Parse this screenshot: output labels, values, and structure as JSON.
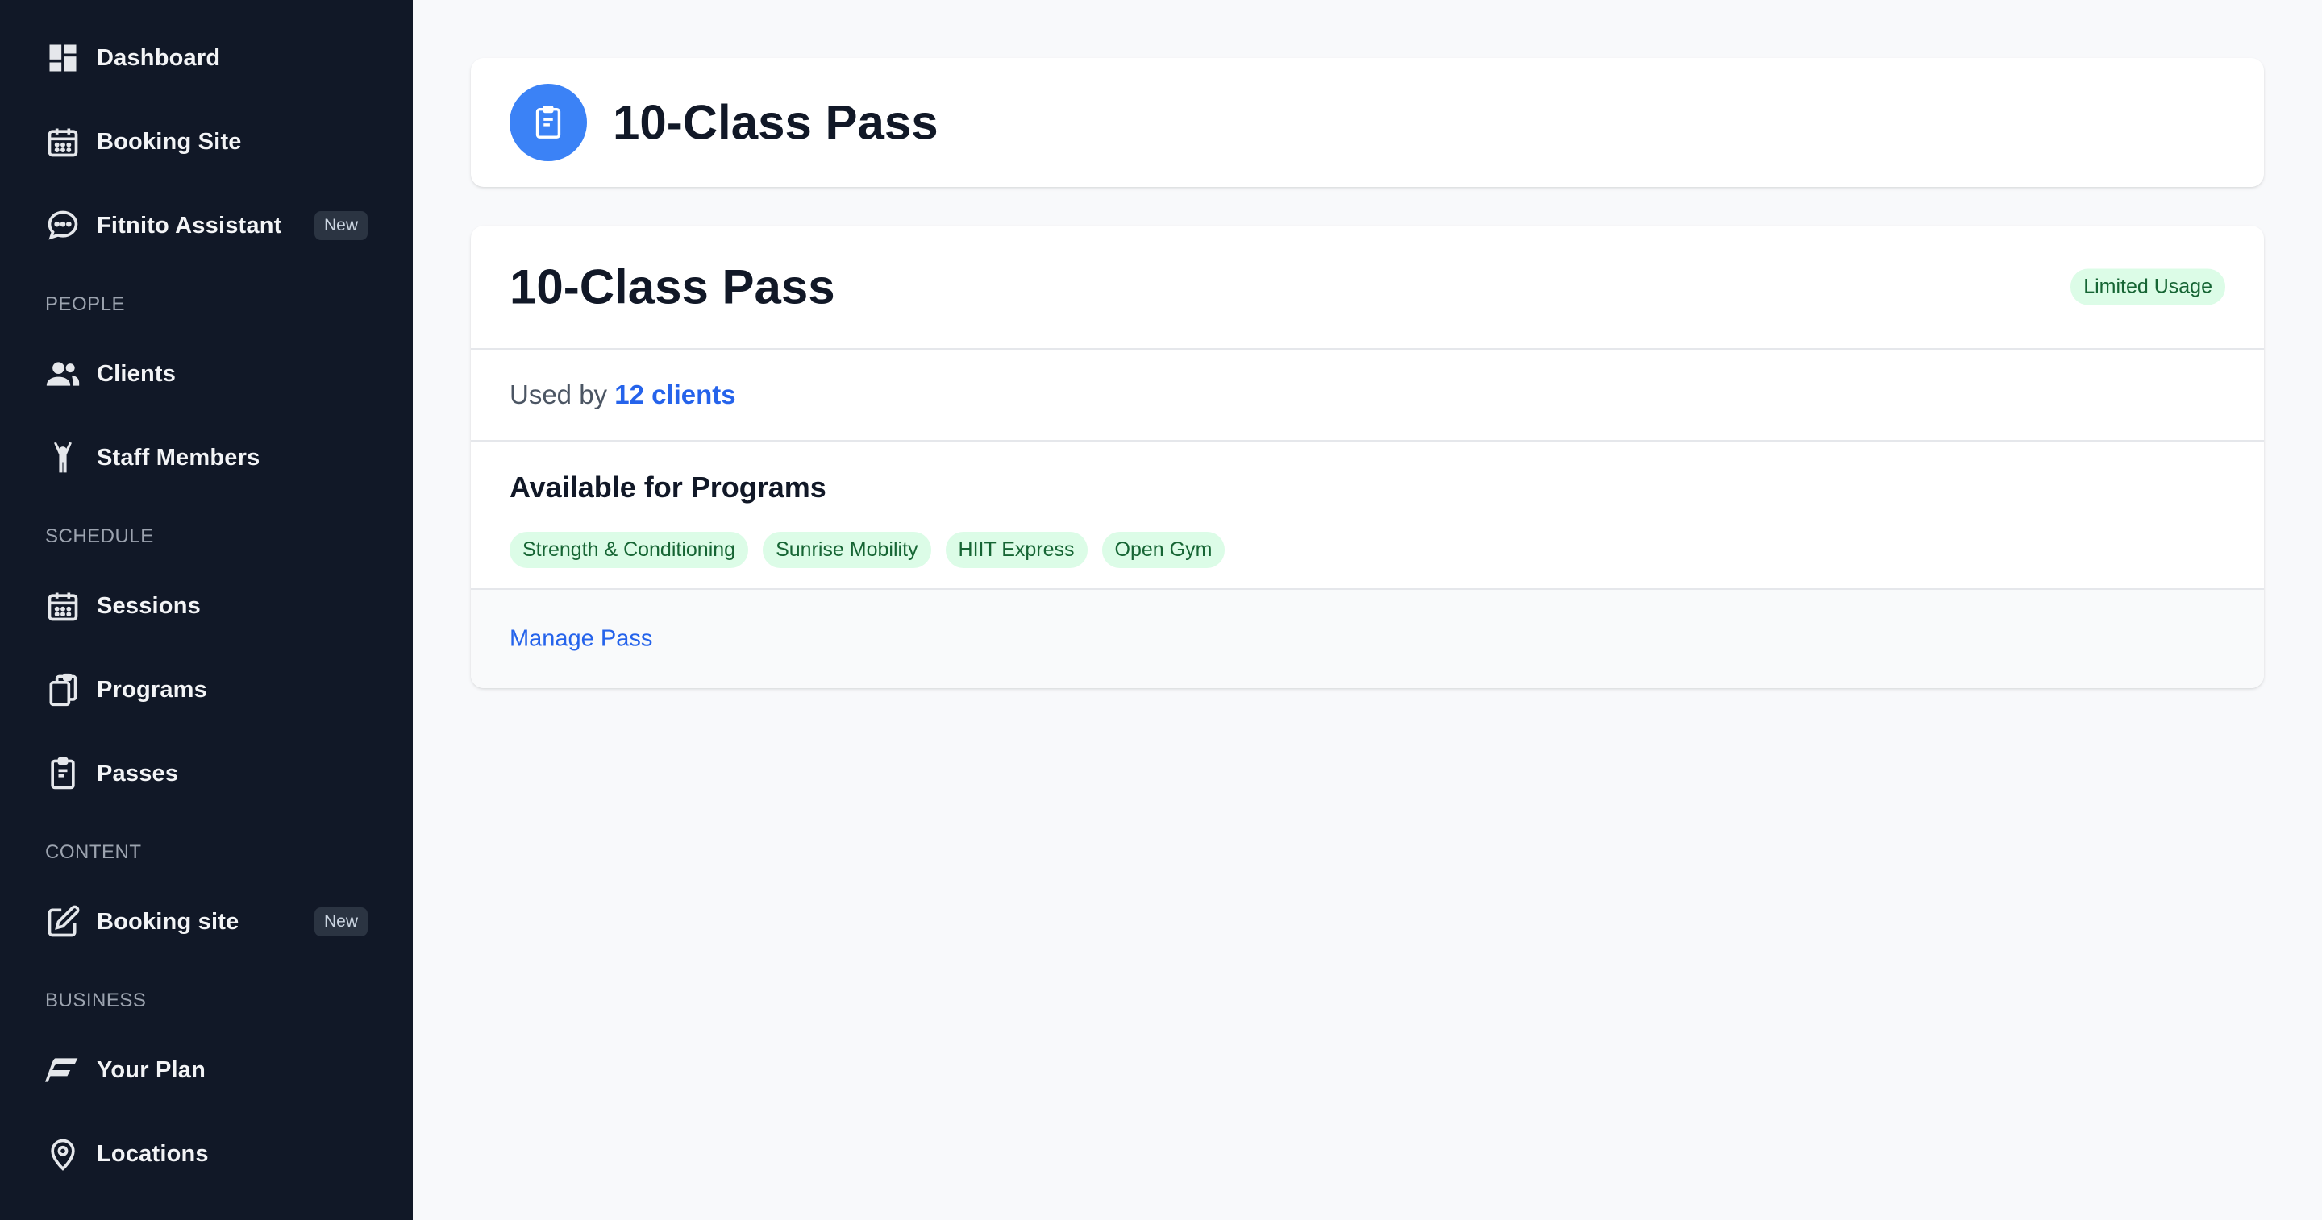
{
  "sidebar": {
    "items": [
      {
        "label": "Dashboard",
        "icon": "dashboard-icon"
      },
      {
        "label": "Booking Site",
        "icon": "calendar-icon"
      },
      {
        "label": "Fitnito Assistant",
        "icon": "chat-bubble-icon",
        "badge": "New"
      },
      {
        "label": "Clients",
        "icon": "users-icon"
      },
      {
        "label": "Staff Members",
        "icon": "person-arms-up-icon"
      },
      {
        "label": "Sessions",
        "icon": "calendar-icon"
      },
      {
        "label": "Programs",
        "icon": "clipboard-copy-icon"
      },
      {
        "label": "Passes",
        "icon": "pass-clipboard-icon"
      },
      {
        "label": "Booking site",
        "icon": "edit-icon",
        "badge": "New"
      },
      {
        "label": "Your Plan",
        "icon": "brand-f-icon"
      },
      {
        "label": "Locations",
        "icon": "map-pin-icon"
      }
    ],
    "sections": {
      "people": "PEOPLE",
      "schedule": "SCHEDULE",
      "content": "CONTENT",
      "business": "BUSINESS"
    }
  },
  "header": {
    "title": "10-Class Pass",
    "icon": "pass-clipboard-icon"
  },
  "pass": {
    "title": "10-Class Pass",
    "usage_badge": "Limited Usage",
    "used_by_prefix": "Used by",
    "used_by_link": "12 clients",
    "programs_heading": "Available for Programs",
    "programs": [
      "Strength & Conditioning",
      "Sunrise Mobility",
      "HIIT Express",
      "Open Gym"
    ],
    "manage_label": "Manage Pass"
  },
  "colors": {
    "sidebar_bg": "#111827",
    "accent": "#3b82f6",
    "link": "#2563eb",
    "tag_bg": "#dcfce7",
    "tag_text": "#166534"
  }
}
